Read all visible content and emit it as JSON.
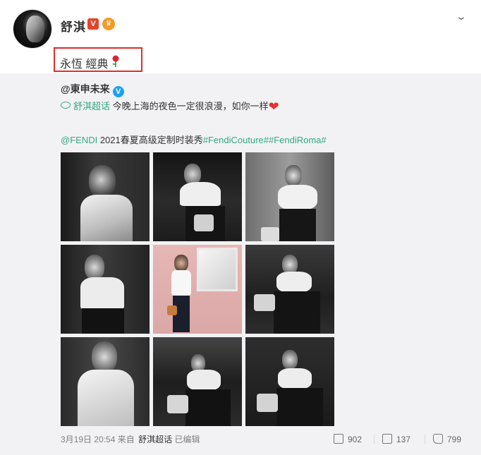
{
  "post": {
    "username": "舒淇",
    "verified_badge": "V",
    "medal_badge": "♛",
    "menu_icon": "chevron-down-icon",
    "text": "永恆 經典",
    "emoji": "rose-icon"
  },
  "repost": {
    "author": "@東申未来",
    "author_badge": "V",
    "topic": "舒淇超话",
    "caption": " 今晚上海的夜色一定很浪漫，如你一样",
    "mention": "@FENDI",
    "brand_text": " 2021春夏高级定制时装秀",
    "hashtags": "#FendiCouture##FendiRoma#",
    "photos": [
      {
        "name": "photo-1",
        "tone": "bw"
      },
      {
        "name": "photo-2",
        "tone": "bw"
      },
      {
        "name": "photo-3",
        "tone": "bw"
      },
      {
        "name": "photo-4",
        "tone": "bw"
      },
      {
        "name": "photo-5",
        "tone": "pink"
      },
      {
        "name": "photo-6",
        "tone": "bw"
      },
      {
        "name": "photo-7",
        "tone": "bw"
      },
      {
        "name": "photo-8",
        "tone": "bw"
      },
      {
        "name": "photo-9",
        "tone": "bw"
      }
    ]
  },
  "footer": {
    "timestamp": "3月19日 20:54",
    "from_label": "来自",
    "source": "舒淇超话",
    "edited": "已编辑",
    "repost_count": "902",
    "comment_count": "137",
    "like_count": "799"
  },
  "colors": {
    "link": "#36a77f",
    "highlight_border": "#e02d2d",
    "repost_bg": "#f2f2f5"
  }
}
